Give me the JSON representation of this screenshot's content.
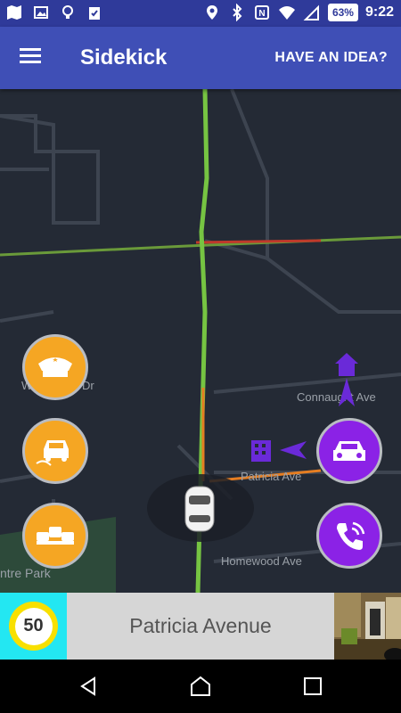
{
  "status_bar": {
    "battery": "63%",
    "time": "9:22"
  },
  "app_bar": {
    "title": "Sidekick",
    "action_label": "HAVE AN IDEA?"
  },
  "map": {
    "street_labels": [
      "W",
      "Dr",
      "Connaught Ave",
      "Patricia Ave",
      "Homewood Ave",
      "ntre Park"
    ]
  },
  "report_buttons": {
    "left": [
      "police-icon",
      "crash-icon",
      "traffic-jam-icon"
    ],
    "right": [
      "car-icon",
      "phone-icon"
    ]
  },
  "info": {
    "speed_limit": "50",
    "current_street": "Patricia Avenue"
  },
  "colors": {
    "status_bar": "#2f3a9a",
    "app_bar": "#3f4fb6",
    "orange": "#f5a623",
    "purple": "#8b22e6",
    "speed_box": "#23e7f2"
  }
}
